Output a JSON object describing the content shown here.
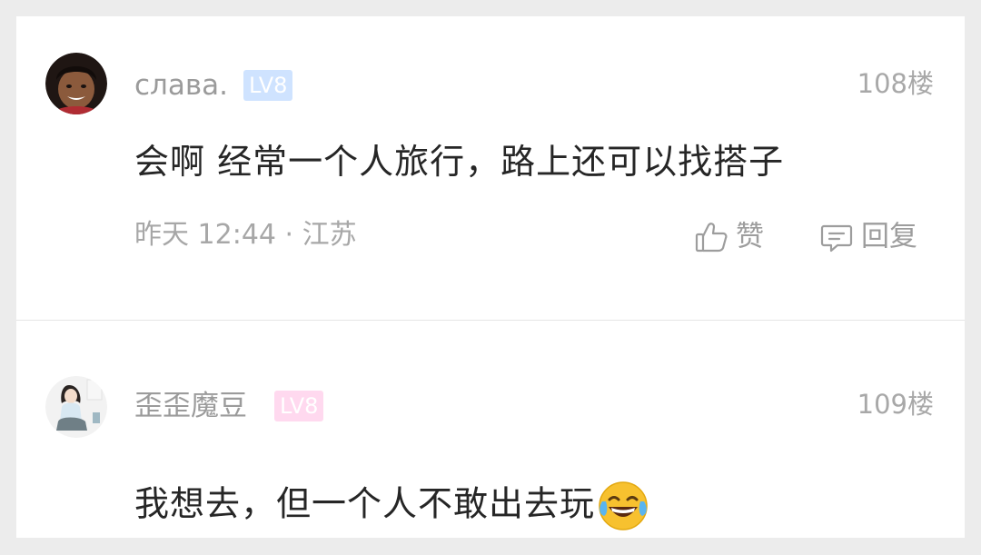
{
  "comments": [
    {
      "username": "слава.",
      "level": "LV8",
      "floor": "108楼",
      "text": "会啊  经常一个人旅行，路上还可以找搭子",
      "meta": "昨天 12:44 · 江苏",
      "actions": {
        "like_label": "赞",
        "reply_label": "回复"
      },
      "badge_color": "#cfe3ff"
    },
    {
      "username": "歪歪魔豆",
      "level": "LV8",
      "floor": "109楼",
      "text": "我想去，但一个人不敢出去玩",
      "badge_color": "#ffd9ef"
    }
  ],
  "icons": {
    "like": "thumbs-up-icon",
    "reply": "reply-bubble-icon",
    "emoji": "tears-of-joy-emoji"
  }
}
